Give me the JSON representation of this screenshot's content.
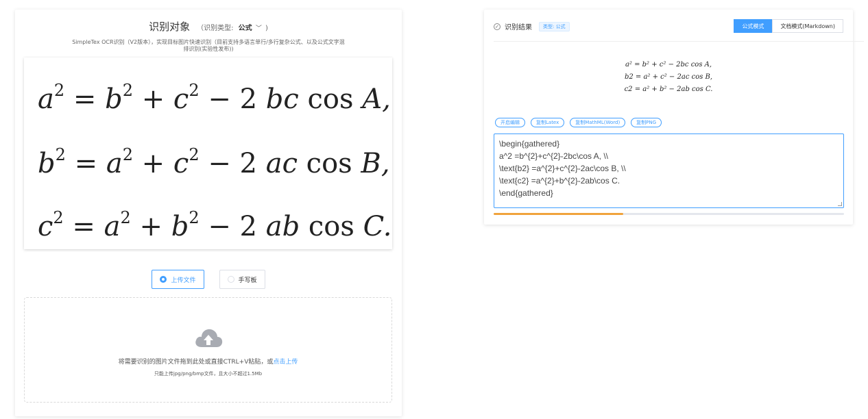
{
  "left": {
    "title": "识别对象",
    "type_prefix": "（识别类型:",
    "type_value": "公式",
    "type_suffix": ")",
    "subtitle": "SimpleTex OCR识别（V2版本），实现目标图片快速识别（目前支持多语言单行/多行复杂公式、以及公式文字混排识别(实验性发布))",
    "formula_lines": [
      {
        "lhs": "a",
        "rest_a": " = b",
        "rest_b": " + c",
        "rest_c": " − 2 ",
        "vars": "bc",
        "fn": " cos ",
        "end": "A,"
      },
      {
        "lhs": "b",
        "rest_a": " = a",
        "rest_b": " + c",
        "rest_c": " − 2 ",
        "vars": "ac",
        "fn": " cos ",
        "end": "B,"
      },
      {
        "lhs": "c",
        "rest_a": " = a",
        "rest_b": " + b",
        "rest_c": " − 2 ",
        "vars": "ab",
        "fn": " cos ",
        "end": "C."
      }
    ],
    "mode_upload": "上传文件",
    "mode_handwrite": "手写板",
    "upload_text": "将需要识别的图片文件拖到此处或直接CTRL+V粘贴，或",
    "upload_link": "点击上传",
    "upload_tip": "只能上传jpg/png/bmp文件，且大小不超过1.5Mb"
  },
  "right": {
    "title": "识别结果",
    "tag": "类型: 公式",
    "seg_formula": "公式模式",
    "seg_doc": "文档模式(Markdown)",
    "rendered": [
      "a² = b² + c² − 2bc cos A,",
      "b2 = a² + c² − 2ac cos B,",
      "c2 = a² + b² − 2ab cos C."
    ],
    "actions": [
      "开启编辑",
      "复制Latex",
      "复制MathML(Word)",
      "复制PNG"
    ],
    "latex_lines": [
      "\\begin{gathered}",
      "a^2 =b^{2}+c^{2}-2bc\\cos A, \\\\",
      "\\text{b2} =a^{2}+c^{2}-2ac\\cos B, \\\\",
      "\\text{c2} =a^{2}+b^{2}-2ab\\cos C.",
      "\\end{gathered}"
    ],
    "progress": 0.37
  },
  "colors": {
    "accent": "#409eff",
    "progress": "#f0a33c"
  },
  "icons": {
    "upload": "cloud-upload-icon",
    "check": "check-circle-icon"
  }
}
